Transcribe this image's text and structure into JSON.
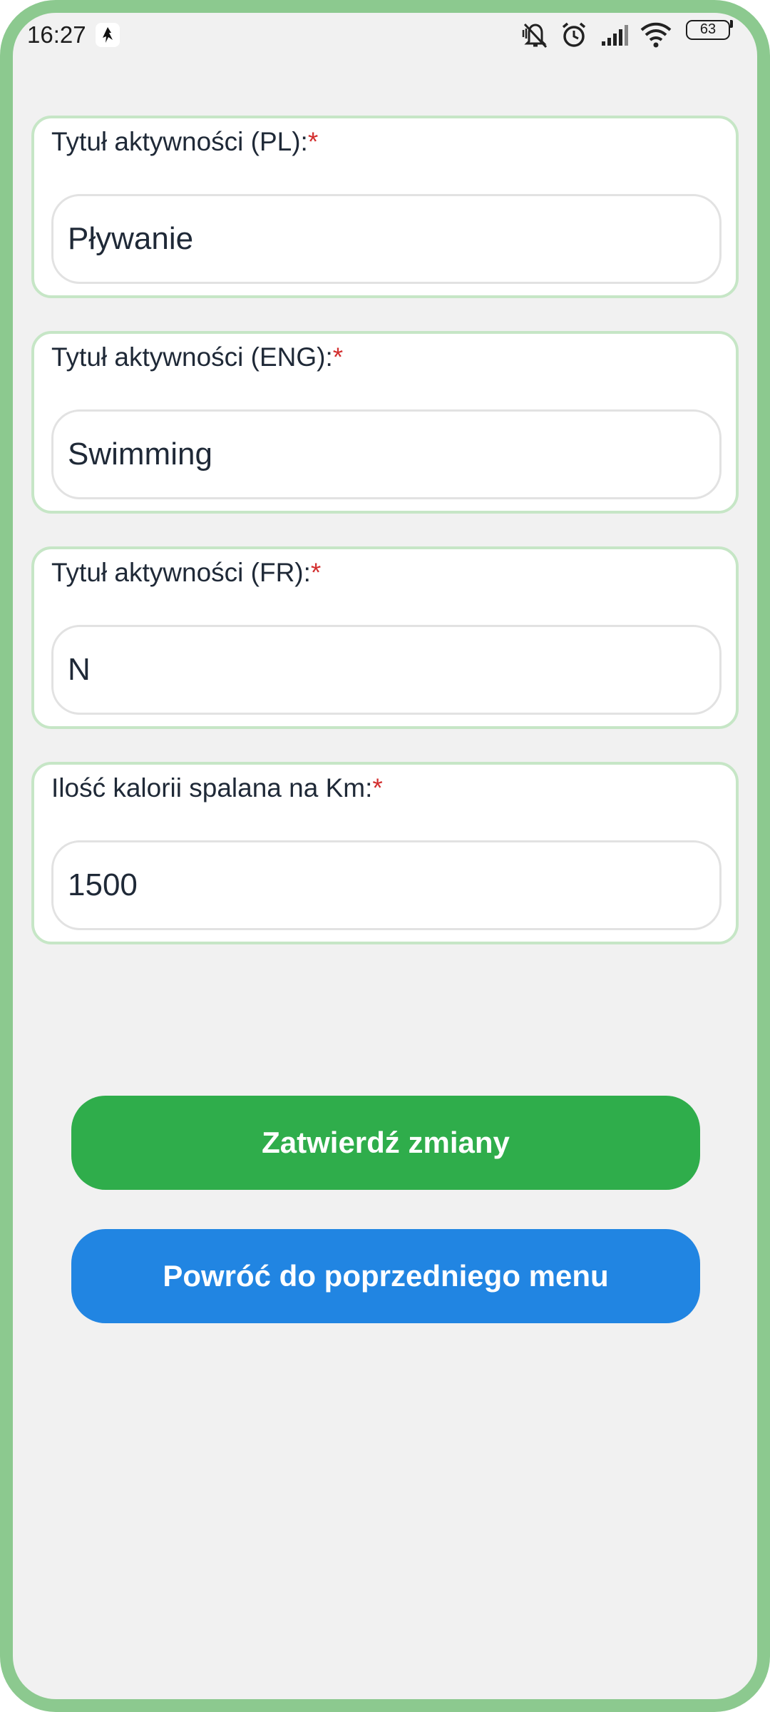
{
  "status_bar": {
    "time": "16:27",
    "battery": "63",
    "icons": [
      "notification-app-icon",
      "mute-icon",
      "alarm-icon",
      "signal-icon",
      "wifi-icon",
      "battery-icon"
    ]
  },
  "form": {
    "fields": [
      {
        "label": "Tytuł aktywności (PL):",
        "required_mark": "*",
        "value": "Pływanie"
      },
      {
        "label": "Tytuł aktywności (ENG):",
        "required_mark": "*",
        "value": "Swimming"
      },
      {
        "label": "Tytuł aktywności (FR):",
        "required_mark": "*",
        "value": "N"
      },
      {
        "label": "Ilość kalorii spalana na Km:",
        "required_mark": "*",
        "value": "1500"
      }
    ]
  },
  "buttons": {
    "confirm_label": "Zatwierdź zmiany",
    "back_label": "Powróć do poprzedniego menu"
  },
  "colors": {
    "frame_border": "#8cc98f",
    "card_border": "#c6e6c6",
    "required": "#d32f2f",
    "confirm_button": "#2fad4b",
    "back_button": "#2185e2"
  }
}
